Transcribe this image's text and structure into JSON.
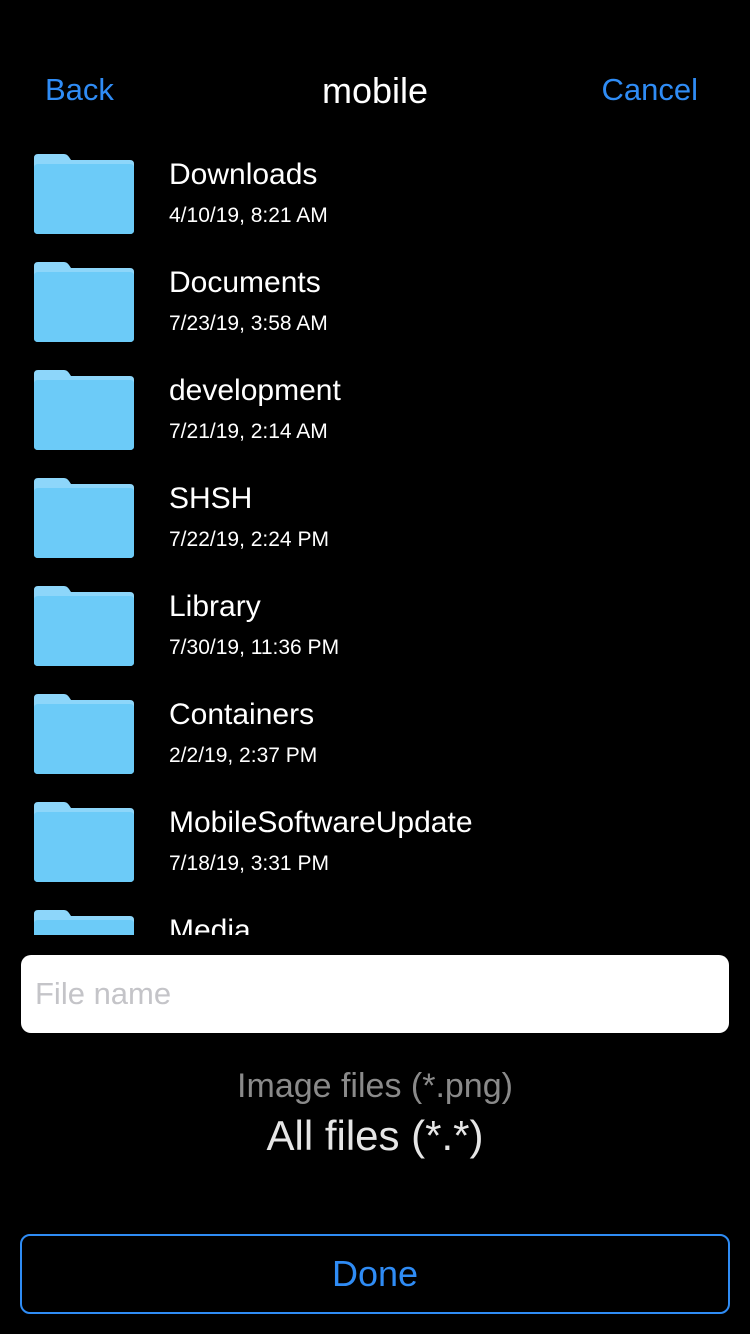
{
  "navbar": {
    "back_label": "Back",
    "title": "mobile",
    "cancel_label": "Cancel"
  },
  "colors": {
    "accent": "#2f8cf5",
    "folder_body": "#6ccbf8",
    "folder_tab": "#8dd6fa",
    "background": "#000000"
  },
  "files": [
    {
      "name": "Downloads",
      "date": "4/10/19, 8:21 AM",
      "icon": "folder-icon"
    },
    {
      "name": "Documents",
      "date": "7/23/19, 3:58 AM",
      "icon": "folder-icon"
    },
    {
      "name": "development",
      "date": "7/21/19, 2:14 AM",
      "icon": "folder-icon"
    },
    {
      "name": "SHSH",
      "date": "7/22/19, 2:24 PM",
      "icon": "folder-icon"
    },
    {
      "name": "Library",
      "date": "7/30/19, 11:36 PM",
      "icon": "folder-icon"
    },
    {
      "name": "Containers",
      "date": "2/2/19, 2:37 PM",
      "icon": "folder-icon"
    },
    {
      "name": "MobileSoftwareUpdate",
      "date": "7/18/19, 3:31 PM",
      "icon": "folder-icon"
    },
    {
      "name": "Media",
      "date": "",
      "icon": "folder-icon"
    }
  ],
  "filename_field": {
    "placeholder": "File name",
    "value": ""
  },
  "file_type_picker": {
    "options_visible": [
      "Image files (*.png)",
      "All files (*.*)"
    ],
    "selected": "All files (*.*)"
  },
  "done_label": "Done"
}
